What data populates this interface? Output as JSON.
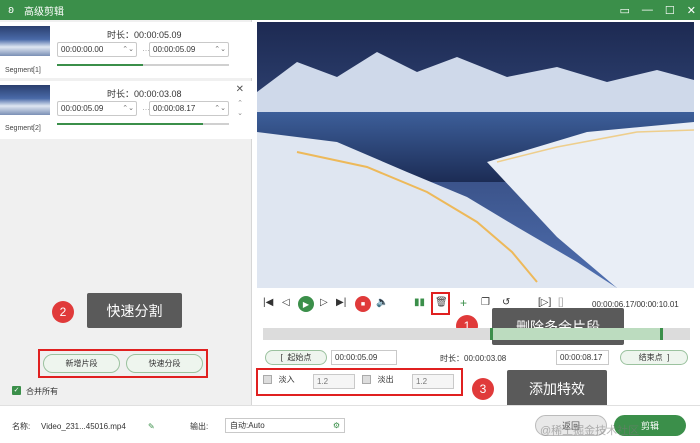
{
  "window": {
    "title": "高级剪辑",
    "icon": "rabbit-logo-icon",
    "controls": [
      "▭",
      "—",
      "☐",
      "✕"
    ]
  },
  "segments": [
    {
      "label": "Segment[1]",
      "duration_label": "时长：00:00:05.09",
      "start": "00:00:00.00",
      "end": "00:00:05.09",
      "progress": 0.5
    },
    {
      "label": "Segment[2]",
      "duration_label": "时长：00:00:03.08",
      "start": "00:00:05.09",
      "end": "00:00:08.17",
      "progress": 0.85
    }
  ],
  "annotations": {
    "a1": {
      "number": "1",
      "text": "删除多余片段"
    },
    "a2": {
      "number": "2",
      "text": "快速分割"
    },
    "a3": {
      "number": "3",
      "text": "添加特效"
    }
  },
  "left_buttons": {
    "add_segment": "新增片段",
    "quick_split": "快速分段"
  },
  "merge_all": {
    "label": "合并所有",
    "checked": true
  },
  "player": {
    "time": "00:00:06.17/00:00:10.01"
  },
  "info_bar": {
    "start_btn": "起始点",
    "start_value": "00:00:05.09",
    "duration_label": "时长：00:00:03.08",
    "end_value": "00:00:08.17",
    "end_btn": "结束点"
  },
  "effects": {
    "fade_in": {
      "label": "淡入",
      "value": "1.2"
    },
    "fade_out": {
      "label": "淡出",
      "value": "1.2"
    }
  },
  "bottom": {
    "name_label": "名称:",
    "name_value": "Video_231...45016.mp4",
    "output_label": "输出:",
    "output_value": "自动:Auto",
    "back_btn": "返回",
    "cut_btn": "剪辑",
    "watermark": "@稀土掘金技术社区"
  },
  "colors": {
    "accent": "#3b8f4a",
    "highlight": "#e02020",
    "annotation_bg": "#5a5a5a"
  }
}
